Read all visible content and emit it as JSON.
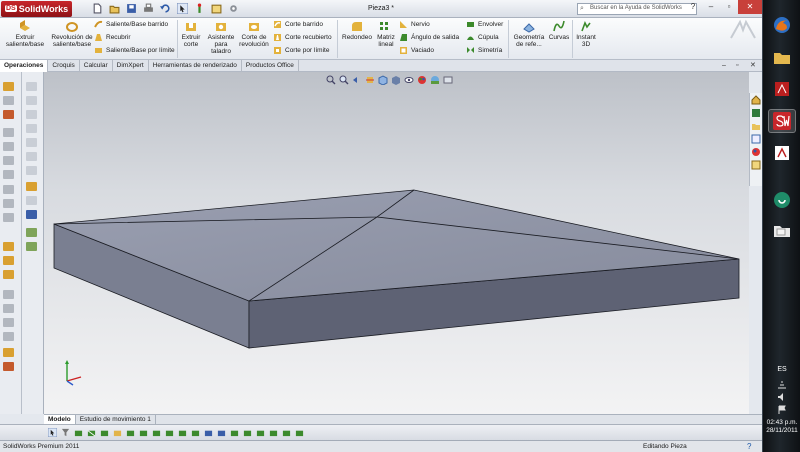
{
  "app": {
    "brand": "SolidWorks",
    "document_title": "Pieza3 *",
    "help_search_placeholder": "Buscar en la Ayuda de SolidWorks"
  },
  "ribbon": {
    "extrude_boss": "Extruir saliente/base",
    "revolve_boss": "Revolución de saliente/base",
    "swept_boss": "Saliente/Base barrido",
    "loft": "Recubrir",
    "boundary_boss": "Saliente/Base por límite",
    "extrude_cut": "Extruir corte",
    "hole_wizard": "Asistente para taladro",
    "revolve_cut": "Corte de revolución",
    "swept_cut": "Corte barrido",
    "lofted_cut": "Corte recubierto",
    "boundary_cut": "Corte por límite",
    "fillet": "Redondeo",
    "linear_pattern": "Matriz lineal",
    "rib": "Nervio",
    "draft": "Ángulo de salida",
    "shell": "Vaciado",
    "wrap": "Envolver",
    "dome": "Cúpula",
    "mirror": "Simetría",
    "ref_geometry": "Geometría de refe...",
    "curves": "Curvas",
    "instant3d": "Instant 3D"
  },
  "tabs": [
    "Operaciones",
    "Croquis",
    "Calcular",
    "DimXpert",
    "Herramientas de renderizado",
    "Productos Office"
  ],
  "bottom_tabs": [
    "Modelo",
    "Estudio de movimiento 1"
  ],
  "status": {
    "product": "SolidWorks Premium 2011",
    "mode": "Editando Pieza"
  },
  "taskbar": {
    "language": "ES",
    "time": "02:43 p.m.",
    "date": "28/11/2011"
  },
  "colors": {
    "solidworks_red": "#c8262b",
    "model_top": "#8e93a4",
    "model_side": "#5e6274",
    "taskbar_bg": "#161b20"
  }
}
